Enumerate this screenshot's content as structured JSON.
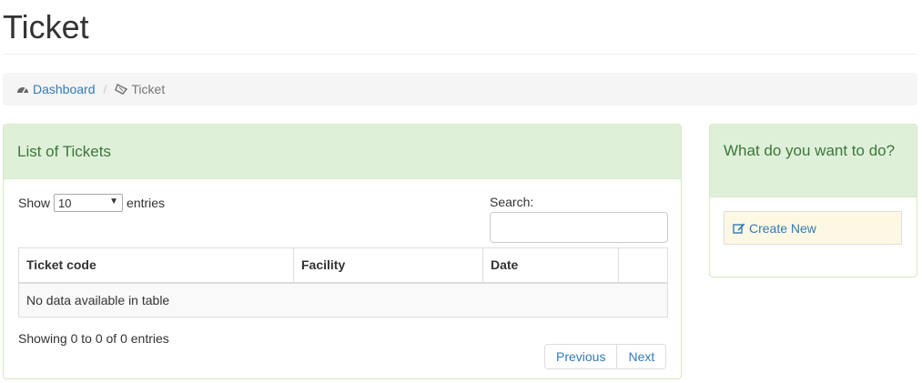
{
  "page": {
    "title": "Ticket"
  },
  "breadcrumb": {
    "items": [
      {
        "label": "Dashboard",
        "icon": "dashboard-icon"
      },
      {
        "label": "Ticket",
        "icon": "ticket-icon"
      }
    ]
  },
  "tickets_panel": {
    "heading": "List of Tickets",
    "length": {
      "prefix": "Show",
      "value": "10",
      "suffix": "entries"
    },
    "search": {
      "label": "Search:",
      "value": ""
    },
    "columns": [
      "Ticket code",
      "Facility",
      "Date",
      ""
    ],
    "empty_message": "No data available in table",
    "info": "Showing 0 to 0 of 0 entries",
    "pagination": {
      "previous": "Previous",
      "next": "Next"
    }
  },
  "actions_panel": {
    "heading": "What do you want to do?",
    "items": [
      {
        "label": "Create New",
        "icon": "edit-icon"
      }
    ]
  },
  "colors": {
    "panel_heading_bg": "#dff0d8",
    "panel_heading_text": "#3c763d",
    "link": "#337ab7",
    "action_bg": "#fcf8e3"
  }
}
